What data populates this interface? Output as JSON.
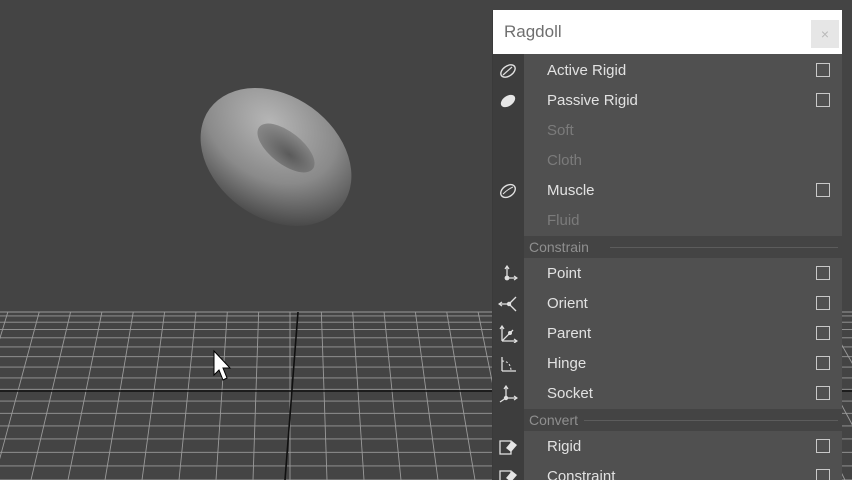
{
  "menu": {
    "title": "Ragdoll",
    "close_label": "×",
    "items_top": [
      {
        "label": "Active Rigid",
        "icon": "active-rigid-icon",
        "enabled": true
      },
      {
        "label": "Passive Rigid",
        "icon": "passive-rigid-icon",
        "enabled": true
      },
      {
        "label": "Soft",
        "icon": "",
        "enabled": false
      },
      {
        "label": "Cloth",
        "icon": "",
        "enabled": false
      },
      {
        "label": "Muscle",
        "icon": "muscle-icon",
        "enabled": true
      },
      {
        "label": "Fluid",
        "icon": "",
        "enabled": false
      }
    ],
    "section_constrain": "Constrain",
    "items_constrain": [
      {
        "label": "Point",
        "icon": "point-constraint-icon"
      },
      {
        "label": "Orient",
        "icon": "orient-constraint-icon"
      },
      {
        "label": "Parent",
        "icon": "parent-constraint-icon"
      },
      {
        "label": "Hinge",
        "icon": "hinge-constraint-icon"
      },
      {
        "label": "Socket",
        "icon": "socket-constraint-icon"
      }
    ],
    "section_convert": "Convert",
    "items_convert": [
      {
        "label": "Rigid",
        "icon": "convert-rigid-icon"
      },
      {
        "label": "Constraint",
        "icon": "convert-constraint-icon"
      }
    ]
  },
  "viewport": {
    "background_color": "#444444",
    "grid_color": "#9a9a9a",
    "axis_color": "#101010"
  }
}
